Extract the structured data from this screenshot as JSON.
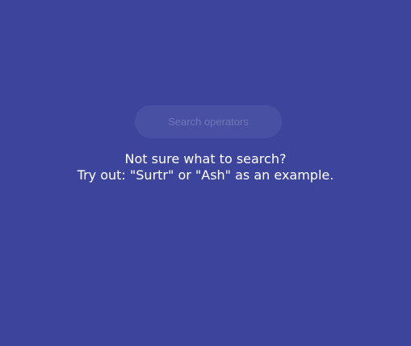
{
  "search": {
    "placeholder": "Search operators",
    "value": ""
  },
  "hint": {
    "line1": "Not sure what to search?",
    "line2": "Try out: \"Surtr\" or \"Ash\" as an example."
  },
  "colors": {
    "background": "#3d449b",
    "search_background": "#4850a3",
    "placeholder": "#7276b6",
    "text": "#ffffff"
  }
}
